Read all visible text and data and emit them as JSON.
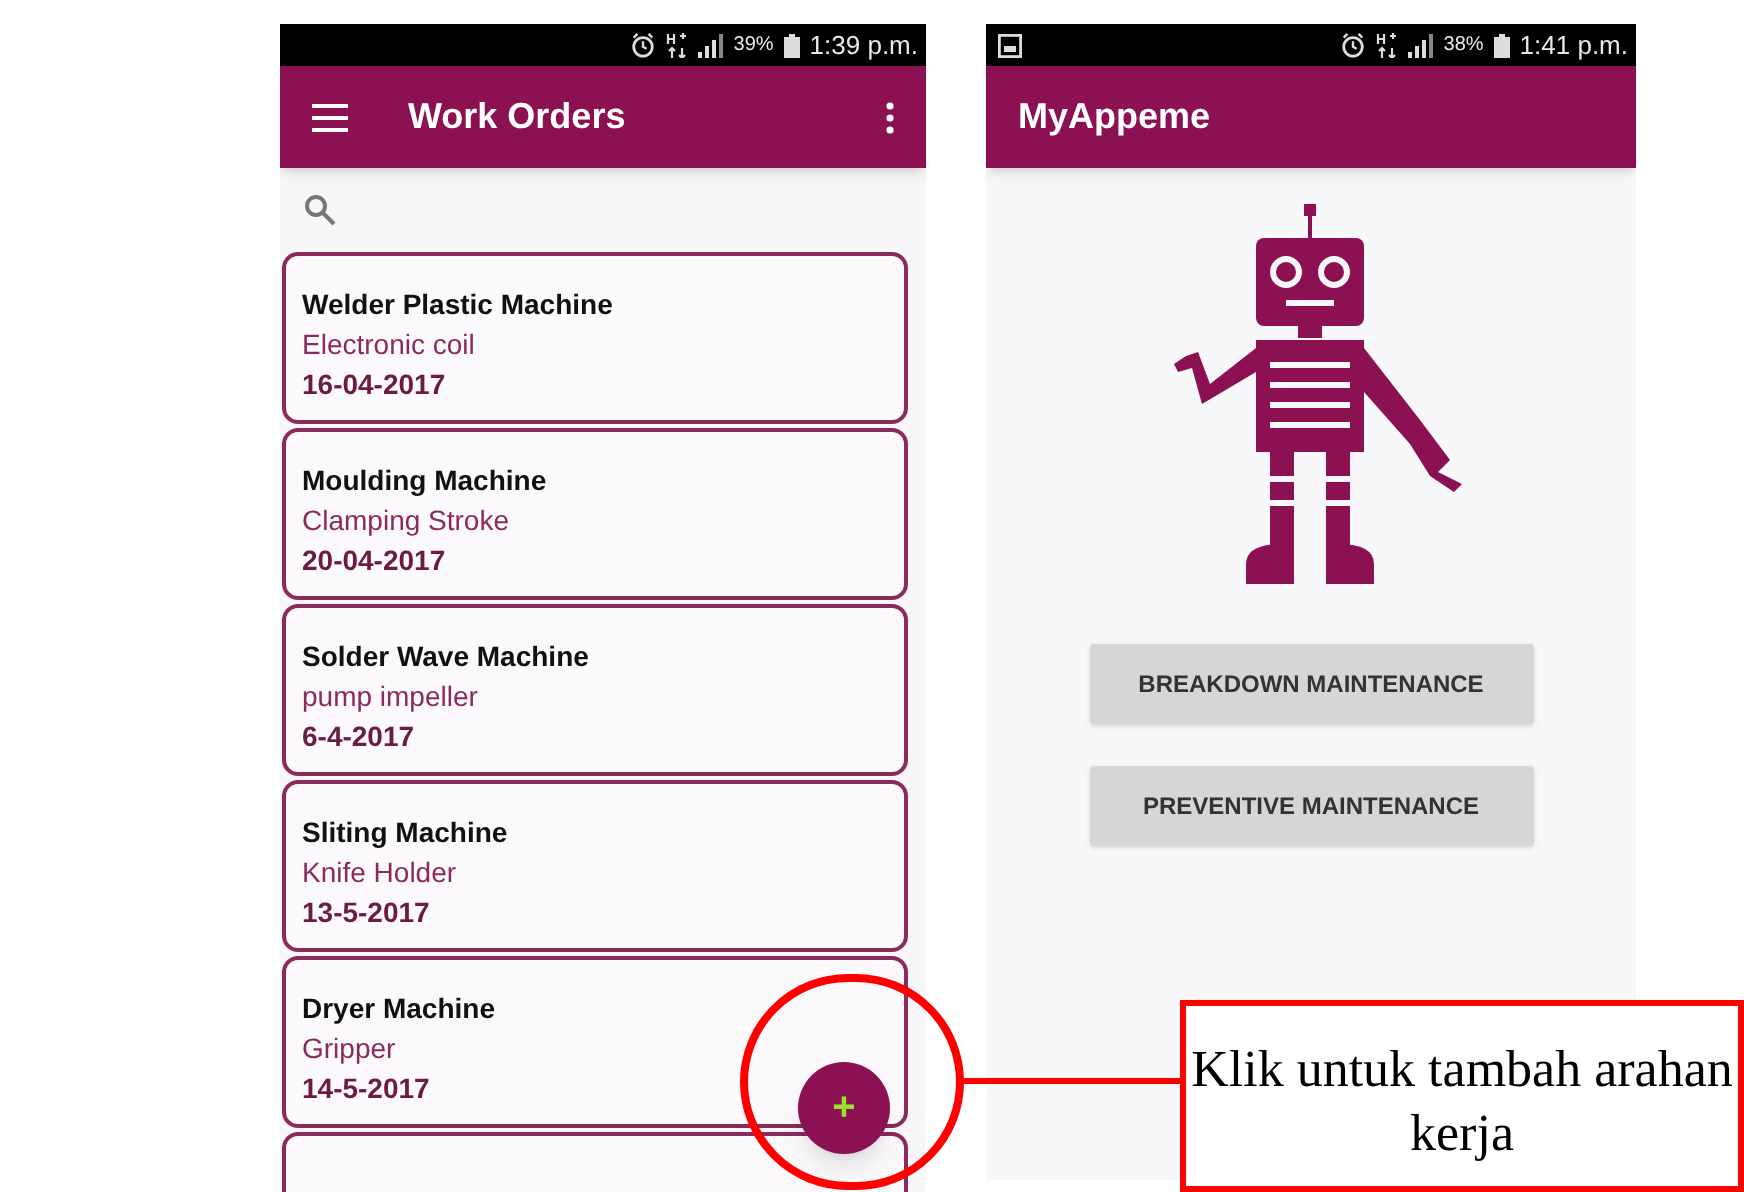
{
  "left_phone": {
    "status_bar": {
      "battery": "39%",
      "time": "1:39 p.m."
    },
    "app_bar": {
      "title": "Work Orders"
    },
    "work_orders": [
      {
        "machine": "Welder Plastic Machine",
        "part": "Electronic coil",
        "date": "16-04-2017"
      },
      {
        "machine": "Moulding Machine",
        "part": "Clamping Stroke",
        "date": "20-04-2017"
      },
      {
        "machine": "Solder Wave Machine",
        "part": "pump impeller",
        "date": "6-4-2017"
      },
      {
        "machine": "Sliting Machine",
        "part": "Knife Holder",
        "date": "13-5-2017"
      },
      {
        "machine": "Dryer Machine",
        "part": "Gripper",
        "date": "14-5-2017"
      }
    ],
    "fab": {
      "label": "+"
    }
  },
  "right_phone": {
    "status_bar": {
      "battery": "38%",
      "time": "1:41 p.m."
    },
    "app_bar": {
      "title": "MyAppeme"
    },
    "buttons": [
      "BREAKDOWN MAINTENANCE",
      "PREVENTIVE MAINTENANCE"
    ]
  },
  "callout": {
    "text": "Klik untuk tambah arahan kerja"
  }
}
